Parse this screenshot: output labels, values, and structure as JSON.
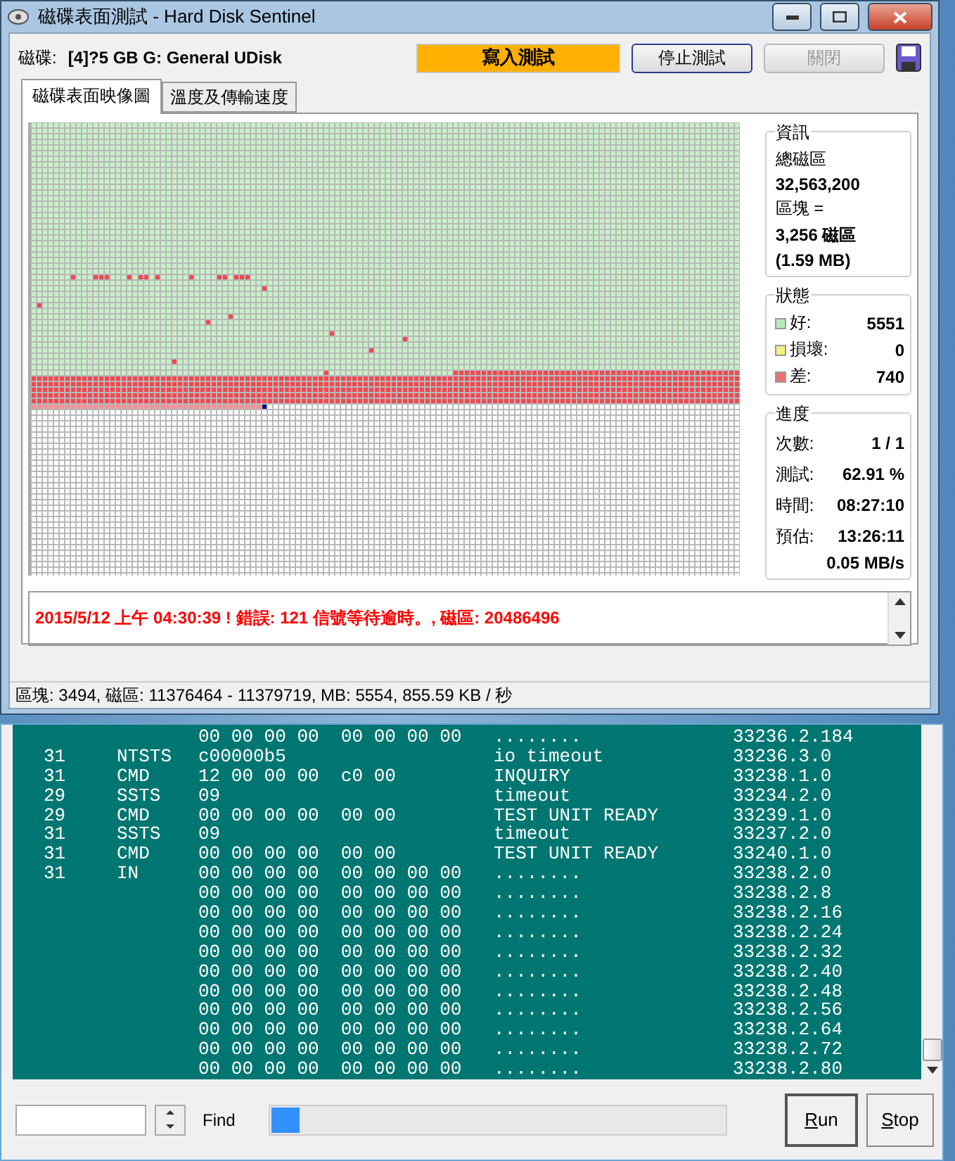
{
  "window": {
    "title": "磁碟表面測試 - Hard Disk Sentinel"
  },
  "header": {
    "disk_label": "磁碟:",
    "disk_value": "[4]?5 GB G: General UDisk",
    "test_status": "寫入測試",
    "buttons": [
      {
        "label": "停止測試",
        "disabled": false
      },
      {
        "label": "關閉",
        "disabled": true
      }
    ]
  },
  "tabs": [
    {
      "label": "磁碟表面映像圖",
      "selected": true
    },
    {
      "label": "溫度及傳輸速度",
      "selected": false
    }
  ],
  "info": {
    "title": "資訊",
    "total_label": "總磁區",
    "total_value": "32,563,200",
    "block_label": "區塊 =",
    "block_value": "3,256 磁區",
    "block_size": "(1.59 MB)"
  },
  "status": {
    "title": "狀態",
    "items": [
      {
        "label": "好:",
        "value": "5551",
        "color": "#b8e8b8"
      },
      {
        "label": "損壞:",
        "value": "0",
        "color": "#f0f080"
      },
      {
        "label": "差:",
        "value": "740",
        "color": "#f07070"
      }
    ]
  },
  "progress": {
    "title": "進度",
    "rows": [
      {
        "label": "次數:",
        "value": "1 / 1"
      },
      {
        "label": "測試:",
        "value": "62.91 %"
      },
      {
        "label": "時間:",
        "value": "08:27:10"
      },
      {
        "label": "預估:",
        "value": "13:26:11"
      }
    ],
    "speed": "0.05 MB/s"
  },
  "log": {
    "lines": [
      "2015/5/12  上午 04:30:39 ! 錯誤: 121 信號等待逾時。, 磁區: 20486496"
    ]
  },
  "status_bar": "區塊: 3494, 磁區: 11376464 - 11379719, MB: 5554, 855.59 KB / 秒",
  "terminal": {
    "rows": [
      {
        "id": "",
        "type": "",
        "hex": "00 00 00 00  00 00 00 00",
        "desc": "........",
        "ref": "33236.2.184"
      },
      {
        "id": "31",
        "type": "NTSTS",
        "hex": "c00000b5",
        "desc": "io timeout",
        "ref": "33236.3.0"
      },
      {
        "id": "31",
        "type": "CMD",
        "hex": "12 00 00 00  c0 00",
        "desc": "INQUIRY",
        "ref": "33238.1.0"
      },
      {
        "id": "29",
        "type": "SSTS",
        "hex": "09",
        "desc": "timeout",
        "ref": "33234.2.0"
      },
      {
        "id": "29",
        "type": "CMD",
        "hex": "00 00 00 00  00 00",
        "desc": "TEST UNIT READY",
        "ref": "33239.1.0"
      },
      {
        "id": "31",
        "type": "SSTS",
        "hex": "09",
        "desc": "timeout",
        "ref": "33237.2.0"
      },
      {
        "id": "31",
        "type": "CMD",
        "hex": "00 00 00 00  00 00",
        "desc": "TEST UNIT READY",
        "ref": "33240.1.0"
      },
      {
        "id": "31",
        "type": "IN",
        "hex": "00 00 00 00  00 00 00 00",
        "desc": "........",
        "ref": "33238.2.0"
      },
      {
        "id": "",
        "type": "",
        "hex": "00 00 00 00  00 00 00 00",
        "desc": "........",
        "ref": "33238.2.8"
      },
      {
        "id": "",
        "type": "",
        "hex": "00 00 00 00  00 00 00 00",
        "desc": "........",
        "ref": "33238.2.16"
      },
      {
        "id": "",
        "type": "",
        "hex": "00 00 00 00  00 00 00 00",
        "desc": "........",
        "ref": "33238.2.24"
      },
      {
        "id": "",
        "type": "",
        "hex": "00 00 00 00  00 00 00 00",
        "desc": "........",
        "ref": "33238.2.32"
      },
      {
        "id": "",
        "type": "",
        "hex": "00 00 00 00  00 00 00 00",
        "desc": "........",
        "ref": "33238.2.40"
      },
      {
        "id": "",
        "type": "",
        "hex": "00 00 00 00  00 00 00 00",
        "desc": "........",
        "ref": "33238.2.48"
      },
      {
        "id": "",
        "type": "",
        "hex": "00 00 00 00  00 00 00 00",
        "desc": "........",
        "ref": "33238.2.56"
      },
      {
        "id": "",
        "type": "",
        "hex": "00 00 00 00  00 00 00 00",
        "desc": "........",
        "ref": "33238.2.64"
      },
      {
        "id": "",
        "type": "",
        "hex": "00 00 00 00  00 00 00 00",
        "desc": "........",
        "ref": "33238.2.72"
      },
      {
        "id": "",
        "type": "",
        "hex": "00 00 00 00  00 00 00 00",
        "desc": "........",
        "ref": "33238.2.80"
      }
    ]
  },
  "toolbar": {
    "find_label": "Find",
    "progress": {
      "level": 0.06
    },
    "buttons": [
      {
        "label": "Run",
        "default": true
      },
      {
        "label": "Stop",
        "default": false
      }
    ]
  }
}
